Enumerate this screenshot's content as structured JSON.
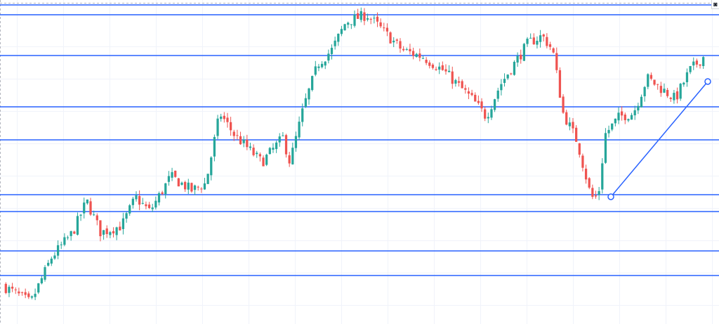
{
  "chart_data": {
    "type": "candlestick",
    "title": "",
    "xlabel": "",
    "ylabel": "",
    "ylim": [
      0,
      461
    ],
    "grid": true,
    "colors": {
      "up": "#26a69a",
      "down": "#ef5350",
      "level_line": "#2962ff",
      "trendline": "#2962ff",
      "grid": "#f0f3fa",
      "background": "#ffffff"
    },
    "horizontal_levels": [
      454,
      440,
      382,
      309,
      262,
      184,
      160,
      104,
      69
    ],
    "trendline": {
      "from": [
        172,
        181
      ],
      "to": [
        302,
        345
      ]
    },
    "anchors": [
      [
        0.0,
        55
      ],
      [
        0.04,
        30
      ],
      [
        0.07,
        95
      ],
      [
        0.1,
        130
      ],
      [
        0.12,
        175
      ],
      [
        0.14,
        130
      ],
      [
        0.17,
        140
      ],
      [
        0.19,
        180
      ],
      [
        0.21,
        160
      ],
      [
        0.24,
        210
      ],
      [
        0.27,
        190
      ],
      [
        0.29,
        200
      ],
      [
        0.31,
        300
      ],
      [
        0.33,
        270
      ],
      [
        0.35,
        250
      ],
      [
        0.37,
        230
      ],
      [
        0.4,
        265
      ],
      [
        0.41,
        230
      ],
      [
        0.43,
        310
      ],
      [
        0.45,
        370
      ],
      [
        0.47,
        390
      ],
      [
        0.49,
        430
      ],
      [
        0.52,
        440
      ],
      [
        0.54,
        420
      ],
      [
        0.57,
        390
      ],
      [
        0.6,
        380
      ],
      [
        0.63,
        360
      ],
      [
        0.65,
        340
      ],
      [
        0.67,
        320
      ],
      [
        0.69,
        295
      ],
      [
        0.71,
        340
      ],
      [
        0.73,
        370
      ],
      [
        0.75,
        400
      ],
      [
        0.77,
        410
      ],
      [
        0.785,
        390
      ],
      [
        0.8,
        300
      ],
      [
        0.82,
        260
      ],
      [
        0.84,
        180
      ],
      [
        0.85,
        181
      ],
      [
        0.86,
        270
      ],
      [
        0.88,
        295
      ],
      [
        0.9,
        300
      ],
      [
        0.92,
        350
      ],
      [
        0.94,
        335
      ],
      [
        0.96,
        320
      ],
      [
        0.98,
        360
      ],
      [
        1.0,
        380
      ]
    ]
  },
  "ui": {
    "corner_button_icon": "camera-icon",
    "corner_button_glyph": "◙"
  }
}
